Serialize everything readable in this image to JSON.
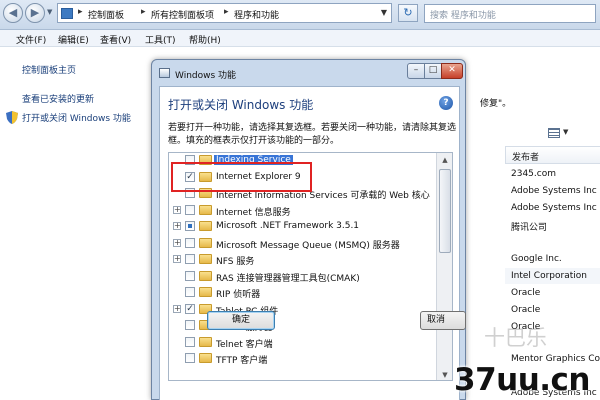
{
  "address_bar": {
    "breadcrumbs": [
      "控制面板",
      "所有控制面板项",
      "程序和功能"
    ],
    "search_placeholder": "搜索 程序和功能"
  },
  "menu": [
    "文件(F)",
    "编辑(E)",
    "查看(V)",
    "工具(T)",
    "帮助(H)"
  ],
  "left_pane": {
    "links": [
      "控制面板主页",
      "查看已安装的更新",
      "打开或关闭 Windows 功能"
    ]
  },
  "background": {
    "fragment_text": "修复\"。",
    "column_header": "发布者",
    "publishers": [
      "2345.com",
      "Adobe Systems Inc",
      "Adobe Systems Inc",
      "腾讯公司",
      "",
      "Google Inc.",
      "Intel Corporation",
      "Oracle",
      "Oracle",
      "Oracle",
      "Mentor Graphics Co",
      "Adobe Systems Inc"
    ]
  },
  "dialog": {
    "title": "Windows 功能",
    "heading": "打开或关闭 Windows 功能",
    "description": "若要打开一种功能，请选择其复选框。若要关闭一种功能，请清除其复选框。填充的框表示仅打开该功能的一部分。",
    "features": [
      {
        "label": "Indexing Service",
        "expandable": false,
        "state": "unchecked",
        "selected": true
      },
      {
        "label": "Internet Explorer 9",
        "expandable": false,
        "state": "checked",
        "selected": false
      },
      {
        "label": "Internet Information Services 可承载的 Web 核心",
        "expandable": false,
        "state": "unchecked",
        "selected": false
      },
      {
        "label": "Internet 信息服务",
        "expandable": true,
        "state": "unchecked",
        "selected": false
      },
      {
        "label": "Microsoft .NET Framework 3.5.1",
        "expandable": true,
        "state": "partial",
        "selected": false
      },
      {
        "label": "Microsoft Message Queue (MSMQ) 服务器",
        "expandable": true,
        "state": "unchecked",
        "selected": false
      },
      {
        "label": "NFS 服务",
        "expandable": true,
        "state": "unchecked",
        "selected": false
      },
      {
        "label": "RAS 连接管理器管理工具包(CMAK)",
        "expandable": false,
        "state": "unchecked",
        "selected": false
      },
      {
        "label": "RIP 侦听器",
        "expandable": false,
        "state": "unchecked",
        "selected": false
      },
      {
        "label": "Tablet PC 组件",
        "expandable": true,
        "state": "checked",
        "selected": false
      },
      {
        "label": "Telnet 服务器",
        "expandable": false,
        "state": "unchecked",
        "selected": false
      },
      {
        "label": "Telnet 客户端",
        "expandable": false,
        "state": "unchecked",
        "selected": false
      },
      {
        "label": "TFTP 客户端",
        "expandable": false,
        "state": "unchecked",
        "selected": false
      }
    ],
    "ok_label": "确定",
    "cancel_label": "取消"
  },
  "watermark": {
    "text": "37uu.cn",
    "faint_text": "十巴乐"
  },
  "colors": {
    "highlight_box": "#e02323",
    "selection": "#3875d7",
    "link": "#1a3f7a"
  }
}
